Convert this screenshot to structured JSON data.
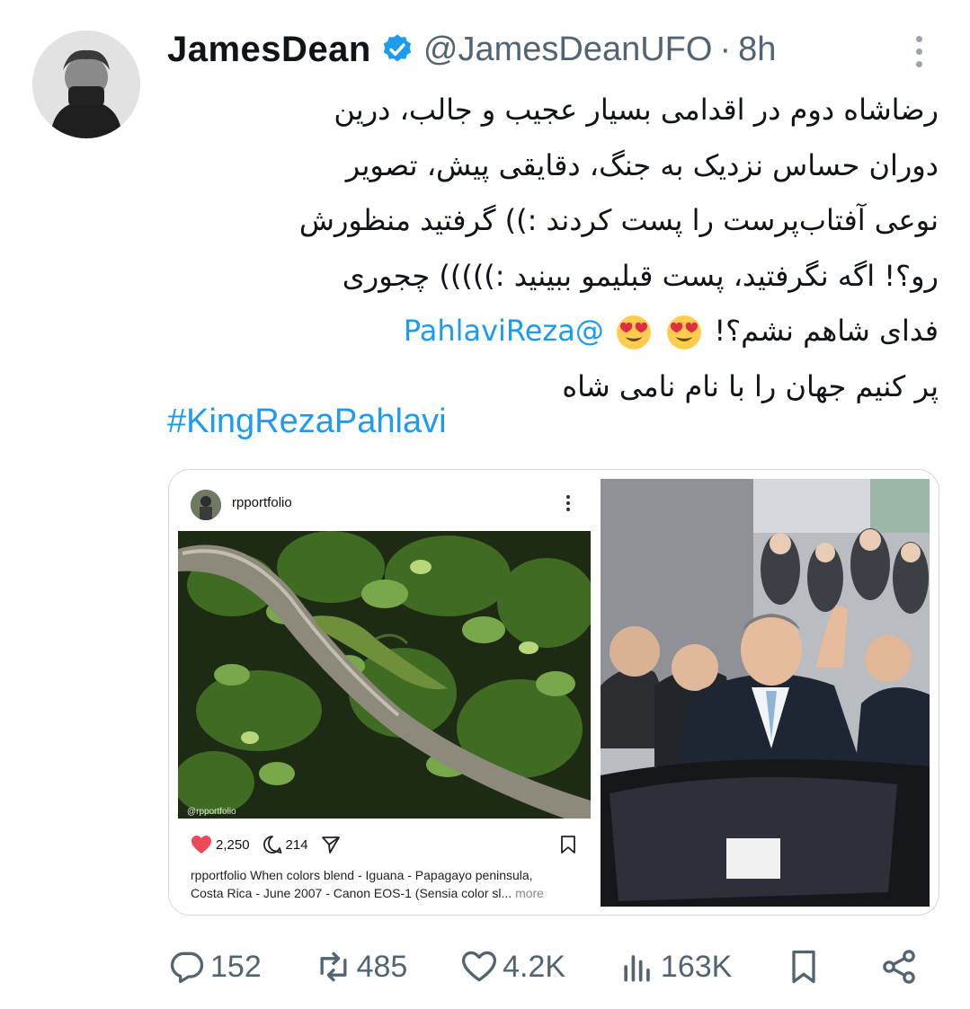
{
  "tweet": {
    "author_name": "JamesDean",
    "author_handle": "@JamesDeanUFO",
    "separator": "·",
    "time": "8h",
    "text_lines": [
      "رضاشاه دوم در اقدامی بسیار عجیب و جالب، درین",
      "دوران حساس نزدیک به جنگ، دقایقی پیش، تصویر",
      "نوعی آفتاب‌پرست را پست کردند :)) گرفتید منظورش",
      "رو؟! اگه نگرفتید، پست قبلیمو ببینید :))))) چجوری"
    ],
    "line5_text": "فدای شاهم نشم؟!",
    "mention": "@PahlaviReza",
    "line6_text": "پر کنیم جهان را با نام نامی شاه",
    "hashtag": "#KingRezaPahlavi"
  },
  "embedded_post": {
    "username": "rpportfolio",
    "watermark": "@rpportfolio",
    "likes": "2,250",
    "comments": "214",
    "caption_line1": "rpportfolio When colors blend - Iguana - Papagayo peninsula,",
    "caption_line2": "Costa Rica - June 2007 - Canon EOS-1 (Sensia color sl...",
    "caption_more": "more"
  },
  "actions": {
    "replies": "152",
    "reposts": "485",
    "likes": "4.2K",
    "views": "163K"
  },
  "colors": {
    "link": "#1d9bf0",
    "muted": "#536471",
    "text": "#0f1419"
  },
  "icons": [
    "verified-badge-icon",
    "more-icon",
    "reply-icon",
    "repost-icon",
    "like-icon",
    "views-icon",
    "bookmark-icon",
    "share-icon"
  ]
}
